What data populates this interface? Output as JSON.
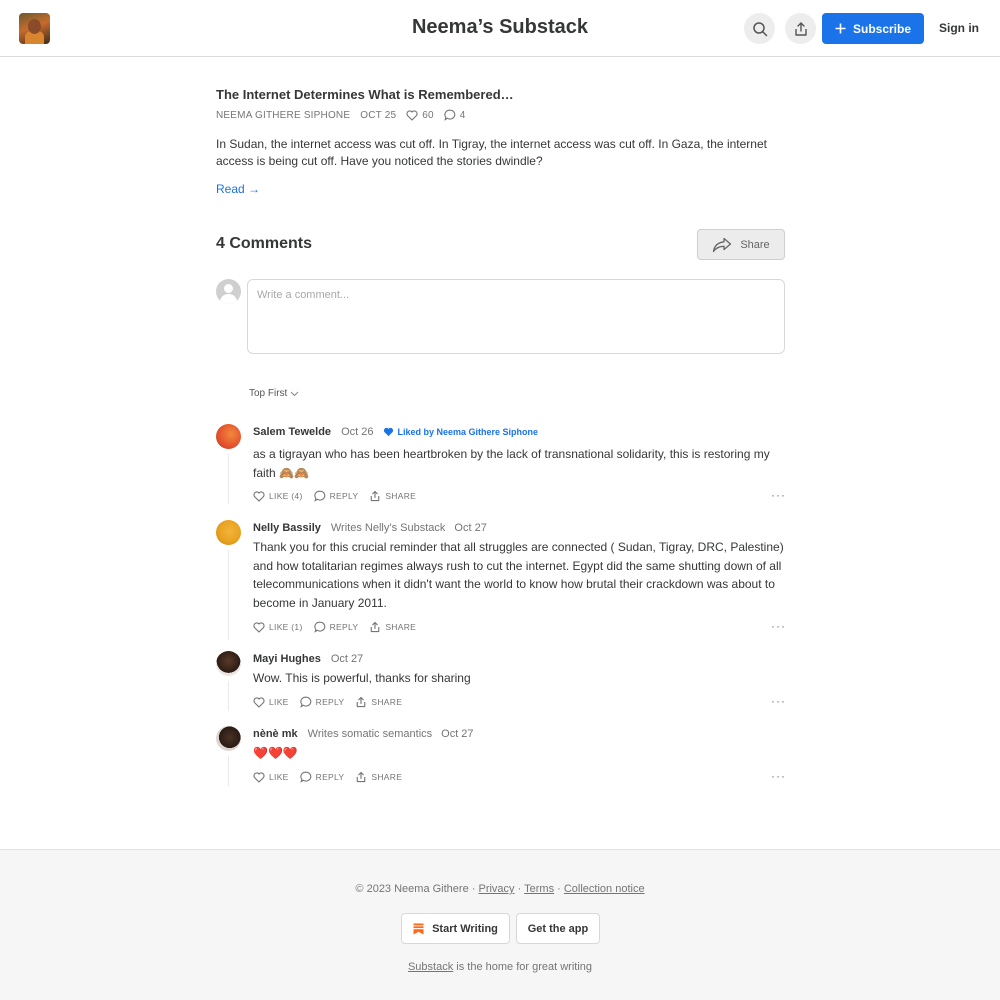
{
  "header": {
    "publication_title": "Neema’s Substack",
    "subscribe_label": "Subscribe",
    "signin_label": "Sign in"
  },
  "post": {
    "title": "The Internet Determines What is Remembered…",
    "author": "NEEMA GITHERE SIPHONE",
    "date": "OCT 25",
    "likes": "60",
    "comments": "4",
    "excerpt": "In Sudan, the internet access was cut off. In Tigray, the internet access was cut off. In Gaza, the internet access is being cut off. Have you noticed the stories dwindle?",
    "read_label": "Read →"
  },
  "comments_section": {
    "heading": "4 Comments",
    "share_label": "Share",
    "input_placeholder": "Write a comment...",
    "sort_label": "Top First"
  },
  "comments": [
    {
      "author": "Salem Tewelde",
      "writes": "",
      "date": "Oct 26",
      "liked_by": "Liked by Neema Githere Siphone",
      "body": "as a tigrayan who has been heartbroken by the lack of transnational solidarity, this is restoring my faith 🙈🙈",
      "like_label": "LIKE (4)",
      "reply_label": "REPLY",
      "share_label": "SHARE",
      "more": "···"
    },
    {
      "author": "Nelly Bassily",
      "writes": "Writes Nelly’s Substack",
      "date": "Oct 27",
      "liked_by": "",
      "body": "Thank you for this crucial reminder that all struggles are connected ( Sudan, Tigray, DRC, Palestine) and how totalitarian regimes always rush to cut the internet. Egypt did the same shutting down of all telecommunications when it didn't want the world to know how brutal their crackdown was about to become in January 2011.",
      "like_label": "LIKE (1)",
      "reply_label": "REPLY",
      "share_label": "SHARE",
      "more": "···"
    },
    {
      "author": "Mayi Hughes",
      "writes": "",
      "date": "Oct 27",
      "liked_by": "",
      "body": "Wow. This is powerful, thanks for sharing",
      "like_label": "LIKE",
      "reply_label": "REPLY",
      "share_label": "SHARE",
      "more": "···"
    },
    {
      "author": "nènè mk",
      "writes": "Writes somatic semantics",
      "date": "Oct 27",
      "liked_by": "",
      "body": "❤️❤️❤️",
      "like_label": "LIKE",
      "reply_label": "REPLY",
      "share_label": "SHARE",
      "more": "···"
    }
  ],
  "footer": {
    "copyright": "© 2023 Neema Githere",
    "privacy": "Privacy",
    "terms": "Terms",
    "collection": "Collection notice",
    "start_writing": "Start Writing",
    "get_app": "Get the app",
    "substack_link": "Substack",
    "tagline": "is the home for great writing"
  },
  "colors": {
    "accent": "#1a73e8",
    "text": "#363737",
    "muted": "#757575"
  }
}
